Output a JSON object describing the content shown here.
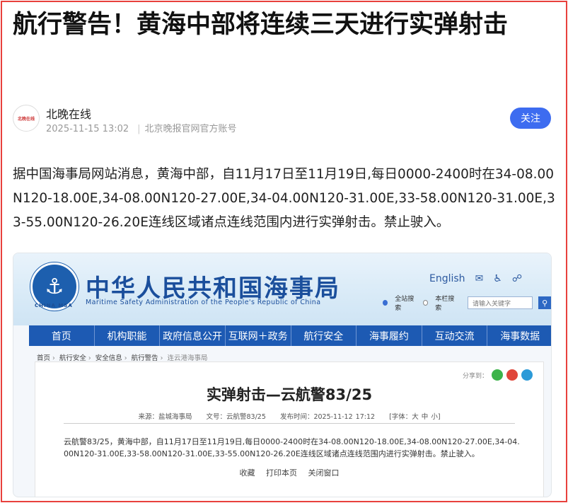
{
  "article": {
    "headline": "航行警告！黄海中部将连续三天进行实弹射击",
    "author_avatar_text": "北晚在线",
    "author_name": "北晚在线",
    "datetime": "2025-11-15 13:02",
    "source": "北京晚报官网官方账号",
    "follow_label": "关注",
    "body": "据中国海事局网站消息，黄海中部，自11月17日至11月19日,每日0000-2400时在34-08.00N120-18.00E,34-08.00N120-27.00E,34-04.00N120-31.00E,33-58.00N120-31.00E,33-55.00N120-26.20E连线区域诸点连线范围内进行实弹射击。禁止驶入。"
  },
  "screenshot": {
    "site_title": "中华人民共和国海事局",
    "site_subtitle": "Maritime Safety Administration of the People's Republic of China",
    "emblem_text": "CHINA MSA",
    "top_links": {
      "english": "English"
    },
    "search": {
      "option1": "全站搜索",
      "option2": "本栏搜索",
      "placeholder": "请输入关键字"
    },
    "nav": [
      "首页",
      "机构职能",
      "政府信息公开",
      "互联网＋政务",
      "航行安全",
      "海事履约",
      "互动交流",
      "海事数据"
    ],
    "breadcrumb": [
      "首页",
      "航行安全",
      "安全信息",
      "航行警告",
      "连云港海事局"
    ],
    "share_label": "分享到：",
    "title": "实弹射击—云航警83/25",
    "meta": {
      "source": "来源：盐城海事局",
      "doc_no": "文号：云航警83/25",
      "publish_time": "发布时间：2025-11-12 17:12",
      "font": "[字体：大 中 小]"
    },
    "body": "云航警83/25，黄海中部，自11月17日至11月19日,每日0000-2400时在34-08.00N120-18.00E,34-08.00N120-27.00E,34-04.00N120-31.00E,33-58.00N120-31.00E,33-55.00N120-26.20E连线区域诸点连线范围内进行实弹射击。禁止驶入。",
    "actions": [
      "收藏",
      "打印本页",
      "关闭窗口"
    ]
  },
  "colors": {
    "frame": "#e8403c",
    "follow": "#3d6cf0",
    "nav": "#1d5ab3",
    "site_title": "#1b4f9c"
  }
}
